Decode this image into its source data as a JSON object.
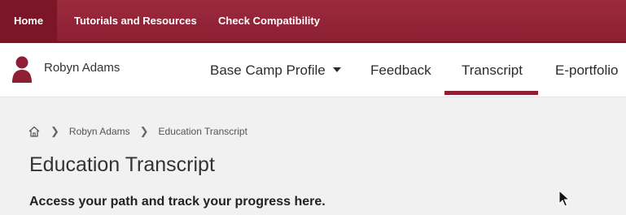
{
  "topnav": {
    "items": [
      {
        "label": "Home"
      },
      {
        "label": "Tutorials and Resources"
      },
      {
        "label": "Check Compatibility"
      }
    ]
  },
  "profile": {
    "user_name": "Robyn Adams",
    "avatar_icon": "person-icon"
  },
  "tabs": [
    {
      "label": "Base Camp Profile",
      "icon": "caret-down-icon"
    },
    {
      "label": "Feedback"
    },
    {
      "label": "Transcript",
      "active": true
    },
    {
      "label": "E-portfolio"
    }
  ],
  "breadcrumb": {
    "home_icon": "home-icon",
    "items": [
      "Robyn Adams",
      "Education Transcript"
    ]
  },
  "page": {
    "title": "Education Transcript",
    "subtitle": "Access your path and track your progress here."
  },
  "colors": {
    "brand": "#8c1f33",
    "home_active": "#7b1528",
    "content_bg": "#f1f1f1"
  }
}
